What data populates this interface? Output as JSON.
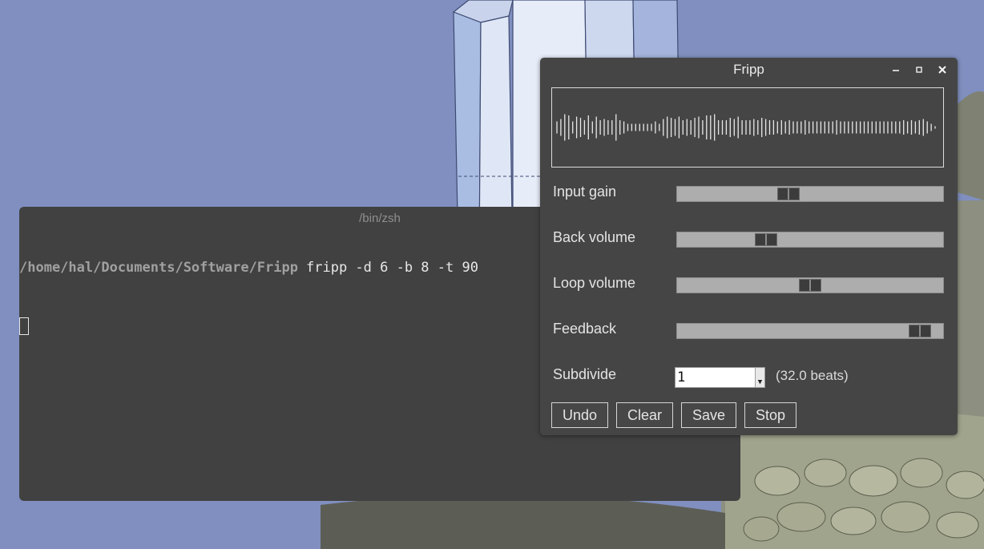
{
  "terminal": {
    "title": "/bin/zsh",
    "prompt_path": "/home/hal/Documents/Software/Fripp",
    "command": "fripp -d 6 -b 8 -t 90"
  },
  "fripp": {
    "title": "Fripp",
    "window_controls": {
      "minimize": "minimize-icon",
      "maximize": "maximize-icon",
      "close": "close-icon"
    },
    "waveform": {
      "color": "#e8e8e8",
      "amplitudes": [
        0.25,
        0.35,
        0.55,
        0.5,
        0.25,
        0.45,
        0.4,
        0.3,
        0.5,
        0.25,
        0.45,
        0.3,
        0.35,
        0.3,
        0.3,
        0.55,
        0.3,
        0.25,
        0.15,
        0.15,
        0.15,
        0.15,
        0.15,
        0.15,
        0.15,
        0.25,
        0.15,
        0.35,
        0.45,
        0.4,
        0.35,
        0.45,
        0.3,
        0.35,
        0.3,
        0.4,
        0.45,
        0.3,
        0.5,
        0.5,
        0.55,
        0.3,
        0.3,
        0.3,
        0.4,
        0.35,
        0.45,
        0.3,
        0.3,
        0.3,
        0.35,
        0.3,
        0.4,
        0.35,
        0.3,
        0.3,
        0.25,
        0.3,
        0.25,
        0.3,
        0.25,
        0.25,
        0.25,
        0.3,
        0.25,
        0.25,
        0.25,
        0.25,
        0.25,
        0.25,
        0.25,
        0.3,
        0.25,
        0.25,
        0.25,
        0.25,
        0.25,
        0.25,
        0.25,
        0.25,
        0.25,
        0.25,
        0.25,
        0.25,
        0.25,
        0.25,
        0.25,
        0.25,
        0.3,
        0.25,
        0.3,
        0.25,
        0.3,
        0.35,
        0.25,
        0.15,
        0.05
      ]
    },
    "controls": [
      {
        "label": "Input gain",
        "value": 0.41
      },
      {
        "label": "Back volume",
        "value": 0.32
      },
      {
        "label": "Loop volume",
        "value": 0.5
      },
      {
        "label": "Feedback",
        "value": 0.95
      }
    ],
    "subdivide": {
      "label": "Subdivide",
      "value": "1",
      "beats": "(32.0 beats)"
    },
    "buttons": {
      "undo": "Undo",
      "clear": "Clear",
      "save": "Save",
      "stop": "Stop"
    }
  }
}
